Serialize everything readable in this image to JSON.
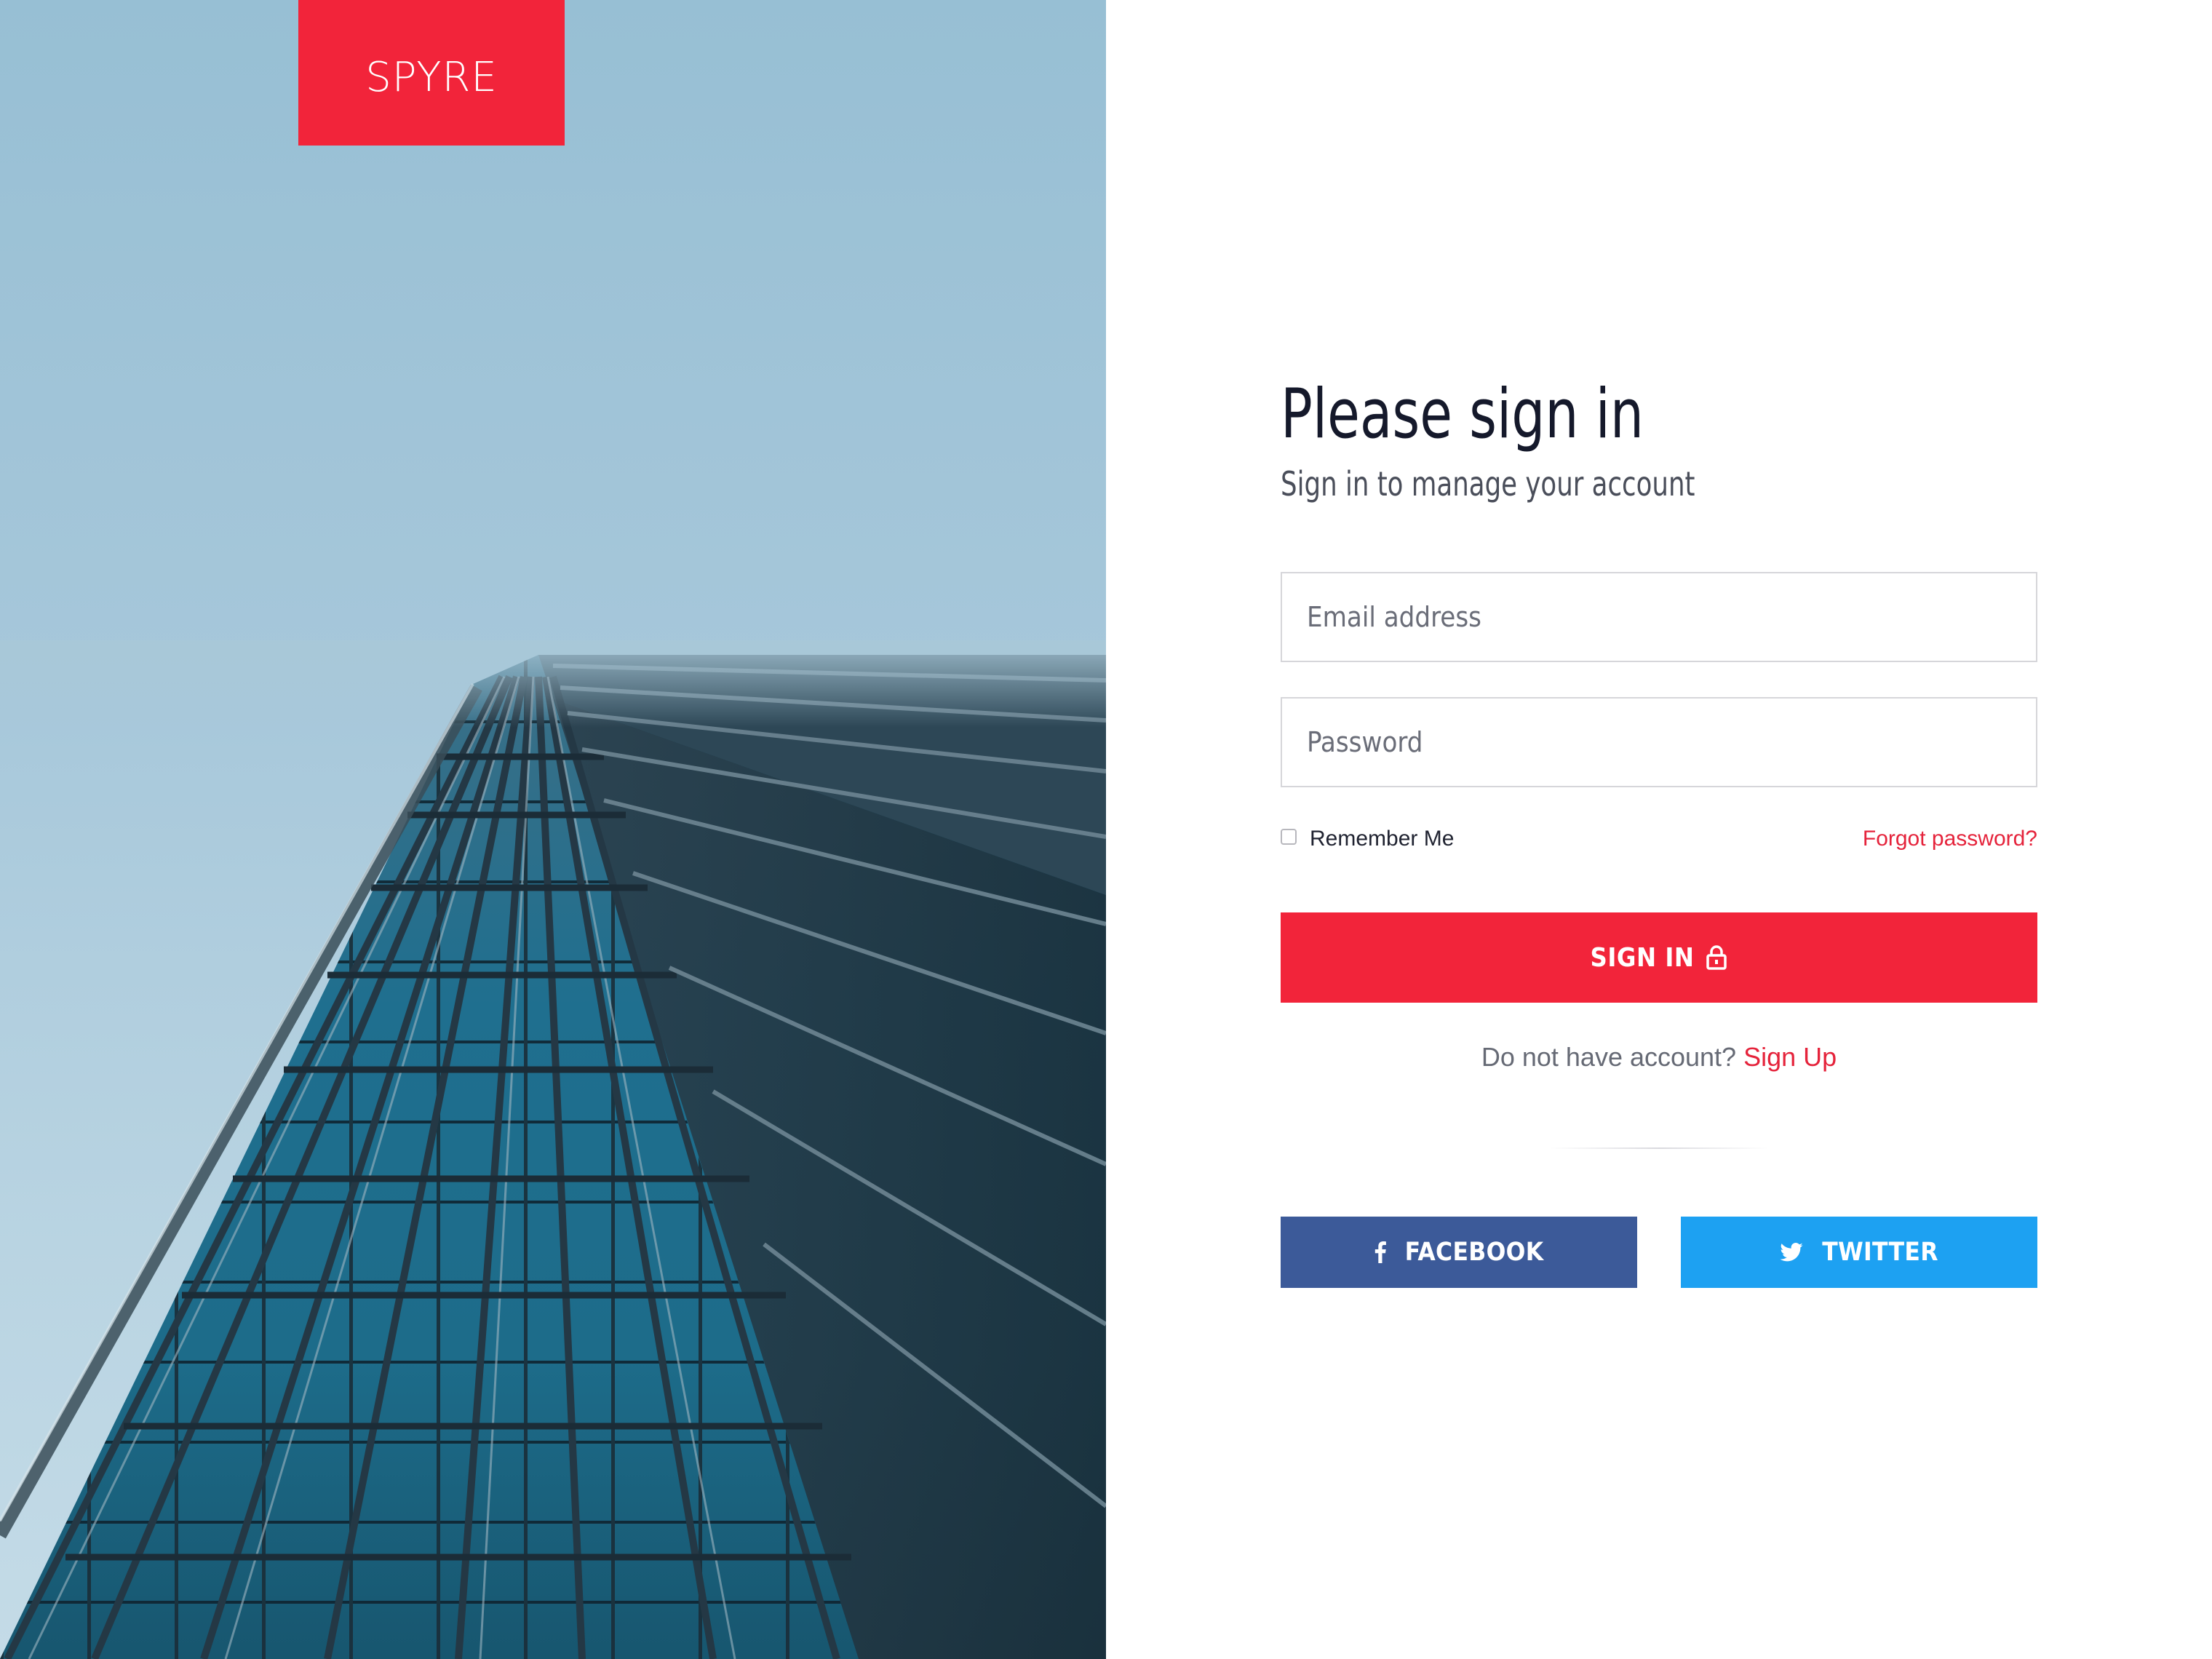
{
  "brand": {
    "logo_text": "SPYRE",
    "accent_color": "#f2243a"
  },
  "hero_image": {
    "icon": "glass-skyscraper-photo"
  },
  "form": {
    "title": "Please sign in",
    "subtitle": "Sign in to manage your account",
    "email_placeholder": "Email address",
    "email_value": "",
    "password_placeholder": "Password",
    "password_value": "",
    "remember_label": "Remember Me",
    "remember_checked": false,
    "forgot_label": "Forgot password?",
    "signin_label": "SIGN IN",
    "signin_icon": "lock-icon",
    "signup_prompt": "Do not have account?",
    "signup_link": "Sign Up"
  },
  "social": {
    "facebook": {
      "label": "FACEBOOK",
      "icon": "facebook-icon",
      "color": "#3c5a99"
    },
    "twitter": {
      "label": "TWITTER",
      "icon": "twitter-icon",
      "color": "#1da1f2"
    }
  }
}
